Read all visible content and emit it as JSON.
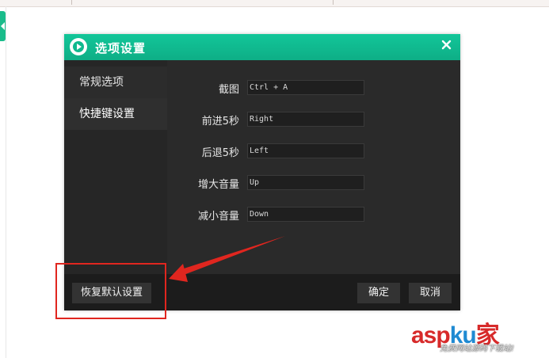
{
  "dialog": {
    "title": "选项设置",
    "close_glyph": "✕"
  },
  "sidebar": {
    "items": [
      {
        "label": "常规选项"
      },
      {
        "label": "快捷键设置"
      }
    ]
  },
  "shortcuts": {
    "rows": [
      {
        "label": "截图",
        "value": "Ctrl + A"
      },
      {
        "label": "前进5秒",
        "value": "Right"
      },
      {
        "label": "后退5秒",
        "value": "Left"
      },
      {
        "label": "增大音量",
        "value": "Up"
      },
      {
        "label": "减小音量",
        "value": "Down"
      }
    ]
  },
  "footer": {
    "restore_label": "恢复默认设置",
    "ok_label": "确定",
    "cancel_label": "取消"
  },
  "watermark": {
    "brand_a": "asp",
    "brand_b": "ku",
    "brand_c": "家",
    "tagline": "免费网站源码下载站!"
  },
  "colors": {
    "accent": "#12c699",
    "annotation": "#e0261f"
  }
}
